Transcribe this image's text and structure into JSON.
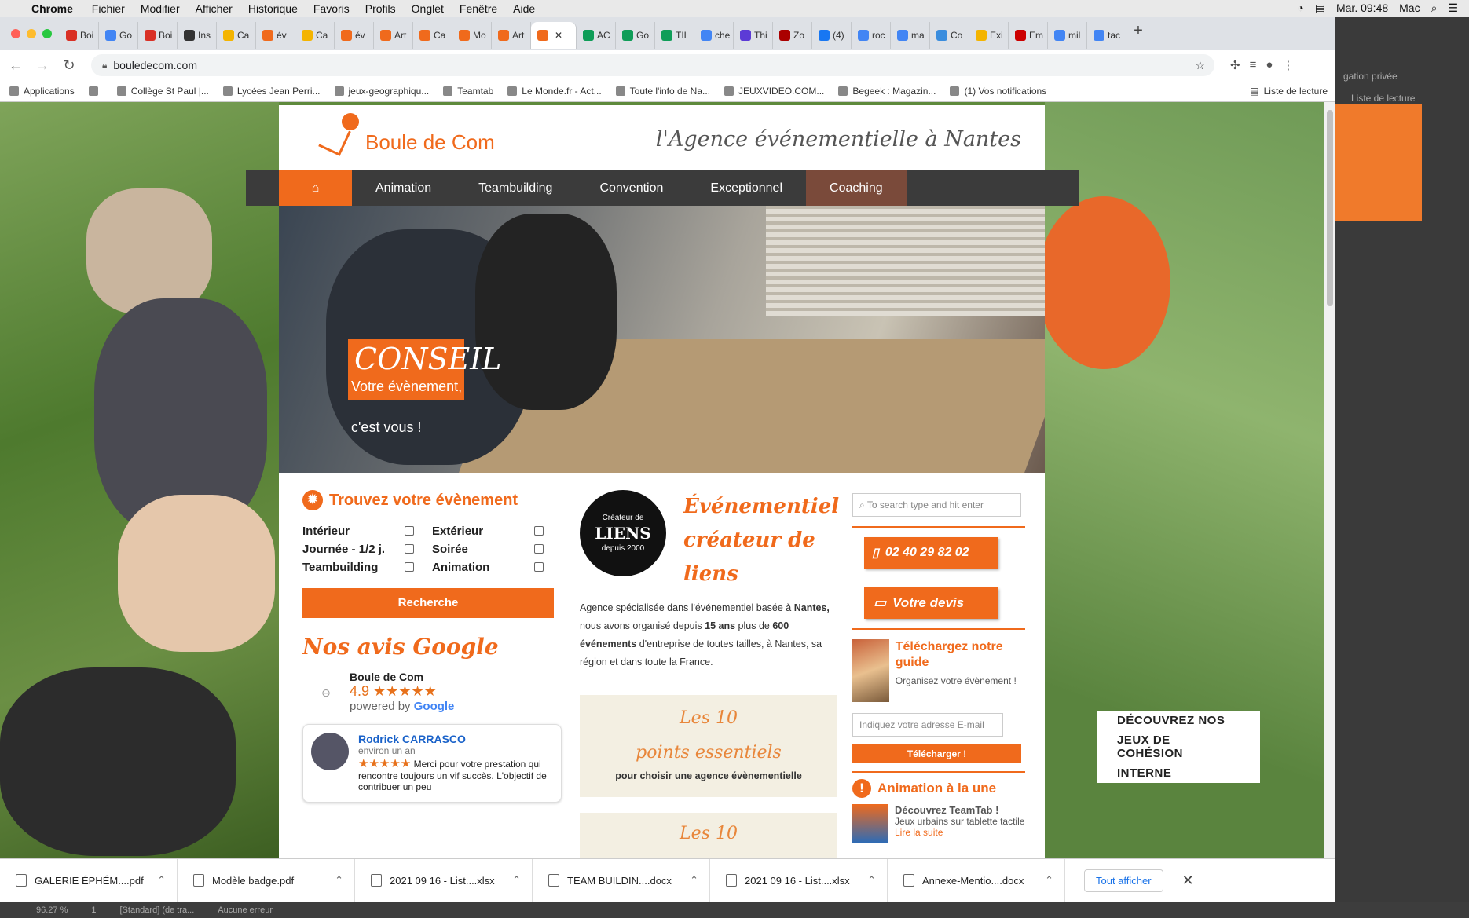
{
  "macbar": {
    "app": "Chrome",
    "menus": [
      "Fichier",
      "Modifier",
      "Afficher",
      "Historique",
      "Favoris",
      "Profils",
      "Onglet",
      "Fenêtre",
      "Aide"
    ],
    "clock": "Mar. 09:48",
    "user": "Mac"
  },
  "tabs": [
    {
      "label": "Boi",
      "icon": "gmail-icon",
      "color": "#d93025"
    },
    {
      "label": "Go",
      "icon": "google-icon",
      "color": "#4285f4"
    },
    {
      "label": "Boi",
      "icon": "gmail-icon",
      "color": "#d93025"
    },
    {
      "label": "Ins",
      "icon": "instagram-icon",
      "color": "#333"
    },
    {
      "label": "Ca",
      "icon": "calendar-icon",
      "color": "#f4b400"
    },
    {
      "label": "év",
      "icon": "bouledecom-icon",
      "color": "#f06a1c"
    },
    {
      "label": "Ca",
      "icon": "calendar-icon",
      "color": "#f4b400"
    },
    {
      "label": "év",
      "icon": "bouledecom-icon",
      "color": "#f06a1c"
    },
    {
      "label": "Art",
      "icon": "bouledecom-icon",
      "color": "#f06a1c"
    },
    {
      "label": "Ca",
      "icon": "bouledecom-icon",
      "color": "#f06a1c"
    },
    {
      "label": "Mo",
      "icon": "bouledecom-icon",
      "color": "#f06a1c"
    },
    {
      "label": "Art",
      "icon": "bouledecom-icon",
      "color": "#f06a1c"
    },
    {
      "label": "",
      "icon": "bouledecom-icon",
      "color": "#f06a1c",
      "active": true
    },
    {
      "label": "AC",
      "icon": "sheets-icon",
      "color": "#0f9d58"
    },
    {
      "label": "Go",
      "icon": "sheets-icon",
      "color": "#0f9d58"
    },
    {
      "label": "TIL",
      "icon": "sheets-icon",
      "color": "#0f9d58"
    },
    {
      "label": "che",
      "icon": "google-icon",
      "color": "#4285f4"
    },
    {
      "label": "Thi",
      "icon": "m-icon",
      "color": "#5c3bd6"
    },
    {
      "label": "Zo",
      "icon": "dp-icon",
      "color": "#a00"
    },
    {
      "label": "(4)",
      "icon": "facebook-icon",
      "color": "#1877f2"
    },
    {
      "label": "roc",
      "icon": "google-icon",
      "color": "#4285f4"
    },
    {
      "label": "ma",
      "icon": "google-icon",
      "color": "#4285f4"
    },
    {
      "label": "Co",
      "icon": "snow-icon",
      "color": "#3a8dde"
    },
    {
      "label": "Exi",
      "icon": "calendar-icon",
      "color": "#f4b400"
    },
    {
      "label": "Em",
      "icon": "em-icon",
      "color": "#c00"
    },
    {
      "label": "mil",
      "icon": "google-icon",
      "color": "#4285f4"
    },
    {
      "label": "tac",
      "icon": "google-icon",
      "color": "#4285f4"
    }
  ],
  "url": "bouledecom.com",
  "bookmarks": [
    "Applications",
    "",
    "Collège St Paul |...",
    "Lycées Jean Perri...",
    "jeux-geographiqu...",
    "Teamtab",
    "Le Monde.fr - Act...",
    "Toute l'info de Na...",
    "JEUXVIDEO.COM...",
    "Begeek : Magazin...",
    "(1) Vos notifications"
  ],
  "reading_list": "Liste de lecture",
  "side": {
    "private": "gation privée",
    "reading": "Liste de lecture"
  },
  "site": {
    "logo": "Boule de Com",
    "tagline": "l'Agence événementielle à Nantes",
    "nav": [
      "Animation",
      "Teambuilding",
      "Convention",
      "Exceptionnel",
      "Coaching"
    ],
    "hero": {
      "big": "CONSEIL",
      "line1": "Votre évènement,",
      "line2": "c'est vous !"
    },
    "find": {
      "title": "Trouvez votre évènement",
      "filters": [
        "Intérieur",
        "Extérieur",
        "Journée - 1/2 j.",
        "Soirée",
        "Teambuilding",
        "Animation"
      ],
      "button": "Recherche"
    },
    "avis": {
      "title": "Nos avis Google",
      "name": "Boule de Com",
      "rating": "4.9",
      "stars": "★★★★★",
      "powered": "powered by",
      "google": "Google"
    },
    "review": {
      "author": "Rodrick CARRASCO",
      "when": "environ un an",
      "stars": "★★★★★",
      "text": "Merci pour votre prestation qui rencontre toujours un vif succès. L'objectif de contribuer un peu"
    },
    "liens": {
      "top": "Créateur de",
      "big": "LIENS",
      "bottom": "depuis 2000",
      "title": "Événementiel créateur de liens"
    },
    "desc": {
      "p1": "Agence spécialisée dans l'événementiel basée à ",
      "city": "Nantes,",
      "p2": " nous avons organisé depuis ",
      "years": "15 ans",
      "p3": " plus de ",
      "count": "600 événements",
      "p4": " d'entreprise de toutes tailles, à Nantes, sa région et dans toute la France."
    },
    "box10": {
      "t1": "Les 10",
      "t2": "points essentiels",
      "sub": "pour choisir une agence évènementielle",
      "t3": "Les 10"
    },
    "search_placeholder": "To search type and hit enter",
    "phone": "02 40 29 82 02",
    "devis": "Votre devis",
    "guide": {
      "title": "Téléchargez notre guide",
      "sub": "Organisez votre évènement !",
      "email_placeholder": "Indiquez votre adresse E-mail",
      "button": "Télécharger !"
    },
    "alaune": {
      "title": "Animation à la une",
      "item": "Découvrez TeamTab !",
      "desc": "Jeux urbains sur tablette tactile",
      "more": "Lire la suite"
    },
    "cohesion": [
      "DÉCOUVREZ NOS",
      "JEUX DE COHÉSION",
      "INTERNE"
    ]
  },
  "downloads": [
    {
      "name": "GALERIE ÉPHÉM....pdf",
      "type": "pdf"
    },
    {
      "name": "Modèle badge.pdf",
      "type": "pdf"
    },
    {
      "name": "2021 09 16 - List....xlsx",
      "type": "xlsx"
    },
    {
      "name": "TEAM BUILDIN....docx",
      "type": "docx"
    },
    {
      "name": "2021 09 16 - List....xlsx",
      "type": "xlsx"
    },
    {
      "name": "Annexe-Mentio....docx",
      "type": "docx"
    }
  ],
  "show_all": "Tout afficher",
  "status": {
    "zoom": "96.27 %",
    "page": "1",
    "style": "[Standard] (de tra...",
    "errors": "Aucune erreur"
  }
}
